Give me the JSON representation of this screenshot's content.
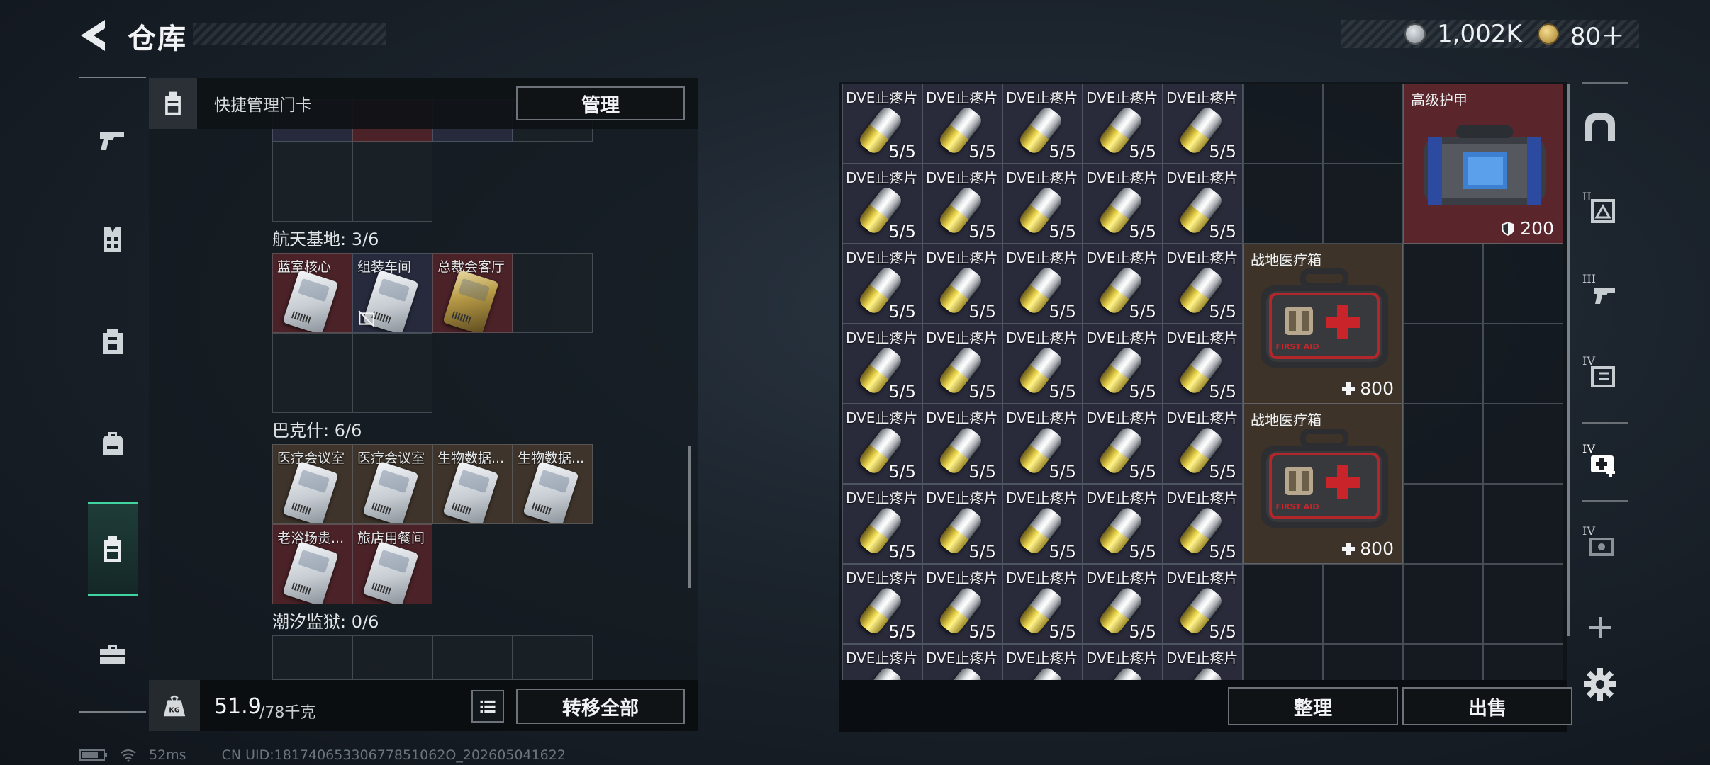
{
  "header": {
    "title": "仓库"
  },
  "currency": [
    {
      "icon": "silver-coin-icon",
      "color": "#9aa3ab",
      "value": "1,002K"
    },
    {
      "icon": "gold-coin-icon",
      "color": "#c9a24a",
      "value": "80＋"
    }
  ],
  "rail": {
    "items": [
      {
        "icon": "pistol-icon"
      },
      {
        "icon": "vest-icon"
      },
      {
        "icon": "armor-icon"
      },
      {
        "icon": "backpack-icon"
      },
      {
        "icon": "keycard-holder-icon",
        "active": true
      },
      {
        "icon": "toolbox-icon"
      }
    ]
  },
  "keycard_bar": {
    "label": "快捷管理门卡",
    "manage_label": "管理"
  },
  "sections": [
    {
      "title": "航天基地: 3/6",
      "cards": [
        {
          "label": "蓝室核心",
          "bg": "red",
          "style": "silver"
        },
        {
          "label": "组装车间",
          "bg": "blue",
          "style": "silver",
          "no_trade": true
        },
        {
          "label": "总裁会客厅",
          "bg": "red",
          "style": "gold"
        }
      ]
    },
    {
      "title": "巴克什: 6/6",
      "cards": [
        {
          "label": "医疗会议室",
          "bg": "brown",
          "style": "silver"
        },
        {
          "label": "医疗会议室",
          "bg": "brown",
          "style": "silver"
        },
        {
          "label": "生物数据...",
          "bg": "brown",
          "style": "silver"
        },
        {
          "label": "生物数据...",
          "bg": "brown",
          "style": "silver"
        },
        {
          "label": "老浴场贵...",
          "bg": "red",
          "style": "silver"
        },
        {
          "label": "旅店用餐间",
          "bg": "red",
          "style": "silver"
        }
      ]
    },
    {
      "title": "潮汐监狱: 0/6",
      "cards": []
    }
  ],
  "weight": {
    "value": "51.9",
    "max": "/78千克"
  },
  "buttons": {
    "transfer_all": "转移全部",
    "organize": "整理",
    "sell": "出售"
  },
  "stash": {
    "pill_name": "DVE止疼片",
    "pill_count": "5/5",
    "pill_rows_full": 7,
    "pill_cols": 5,
    "armor": {
      "name": "高级护甲",
      "stat": "200",
      "icon": "shield-icon"
    },
    "medkits": [
      {
        "name": "战地医疗箱",
        "stat": "800",
        "icon": "plus-icon"
      },
      {
        "name": "战地医疗箱",
        "stat": "800",
        "icon": "plus-icon"
      }
    ]
  },
  "tabs": [
    {
      "icon": "tab-home-icon"
    },
    {
      "icon": "tab-2-icon",
      "roman": "II"
    },
    {
      "icon": "tab-3-icon",
      "roman": "III"
    },
    {
      "icon": "tab-4-icon",
      "roman": "IV"
    },
    {
      "icon": "tab-medical-icon",
      "roman": "IV",
      "active": true
    },
    {
      "icon": "tab-6-icon",
      "roman": "IV"
    },
    {
      "icon": "add-tab-icon"
    },
    {
      "icon": "settings-icon"
    }
  ],
  "status": {
    "ping": "52ms",
    "uid": "CN UID:18174065330677851062O_202605041622"
  },
  "colors": {
    "accent": "#41d3a0",
    "keycard_red": "#4a2227",
    "keycard_blue": "#262a3c",
    "keycard_brown": "#3e342b",
    "armor_bg": "#5a262b",
    "medkit_bg": "#3d3328"
  }
}
